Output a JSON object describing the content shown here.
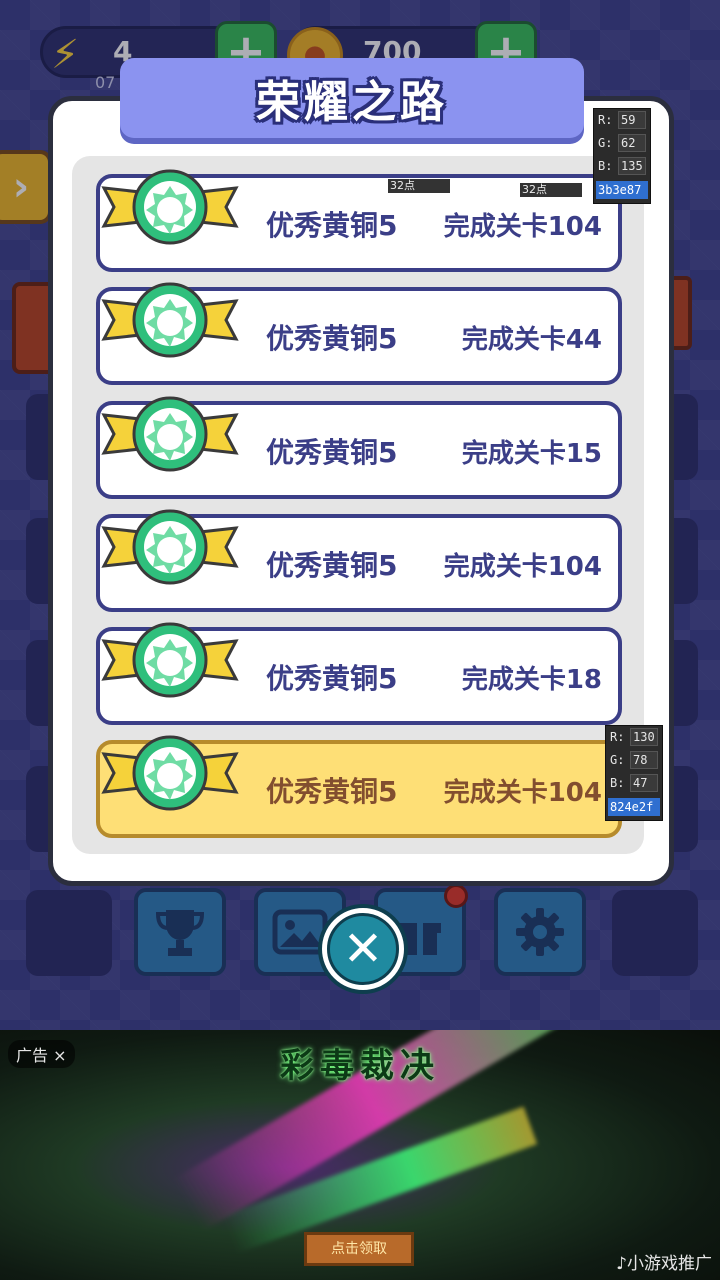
{
  "hud": {
    "energy_value": "4",
    "energy_sub": "07",
    "coin_value": "700",
    "plus": "+"
  },
  "dialog": {
    "title": "荣耀之路",
    "rows": [
      {
        "name": "优秀黄铜5",
        "condition": "完成关卡104",
        "highlighted": false
      },
      {
        "name": "优秀黄铜5",
        "condition": "完成关卡44",
        "highlighted": false
      },
      {
        "name": "优秀黄铜5",
        "condition": "完成关卡15",
        "highlighted": false
      },
      {
        "name": "优秀黄铜5",
        "condition": "完成关卡104",
        "highlighted": false
      },
      {
        "name": "优秀黄铜5",
        "condition": "完成关卡18",
        "highlighted": false
      },
      {
        "name": "优秀黄铜5",
        "condition": "完成关卡104",
        "highlighted": true
      }
    ]
  },
  "pickers": [
    {
      "r_label": "R:",
      "r": "59",
      "g_label": "G:",
      "g": "62",
      "b_label": "B:",
      "b": "135",
      "hex": "3b3e87"
    },
    {
      "r_label": "R:",
      "r": "130",
      "g_label": "G:",
      "g": "78",
      "b_label": "B:",
      "b": "47",
      "hex": "824e2f"
    }
  ],
  "point_labels": [
    "32点",
    "32点"
  ],
  "ad": {
    "label": "广告 ×",
    "title": "彩毒裁决",
    "cta": "点击领取",
    "brand": "♪小游戏推广"
  },
  "icons": {
    "energy": "lightning-icon",
    "coin": "coin-icon",
    "trophy": "trophy-icon",
    "gallery": "image-icon",
    "gift": "gift-icon",
    "settings": "gear-icon",
    "close": "close-icon"
  },
  "colors": {
    "row_text": "#3b3e87",
    "row_text_highlight": "#824e2f",
    "title_bg": "#8b93f0",
    "row_highlight_bg": "#fedf76"
  }
}
